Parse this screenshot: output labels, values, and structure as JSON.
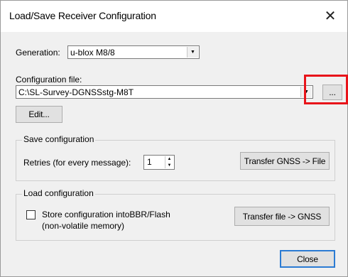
{
  "window": {
    "title": "Load/Save Receiver Configuration",
    "close_symbol": "✕"
  },
  "generation": {
    "label": "Generation:",
    "value": "u-blox M8/8"
  },
  "config_file": {
    "label": "Configuration file:",
    "value": "C:\\SL-Survey-DGNSSstg-M8T",
    "browse_label": "...",
    "edit_label": "Edit..."
  },
  "save_group": {
    "title": "Save configuration",
    "retries_label": "Retries (for every message):",
    "retries_value": "1",
    "transfer_label": "Transfer GNSS -> File"
  },
  "load_group": {
    "title": "Load configuration",
    "store_line1": "Store configuration intoBBR/Flash",
    "store_line2": "(non-volatile memory)",
    "store_checked": false,
    "transfer_label": "Transfer file -> GNSS"
  },
  "footer": {
    "close_label": "Close"
  },
  "colors": {
    "highlight": "#e8141a",
    "default_button_border": "#2b7bd3"
  },
  "icons": {
    "dropdown": "chevron-down-icon",
    "spin_up": "spin-up-icon",
    "spin_down": "spin-down-icon"
  }
}
